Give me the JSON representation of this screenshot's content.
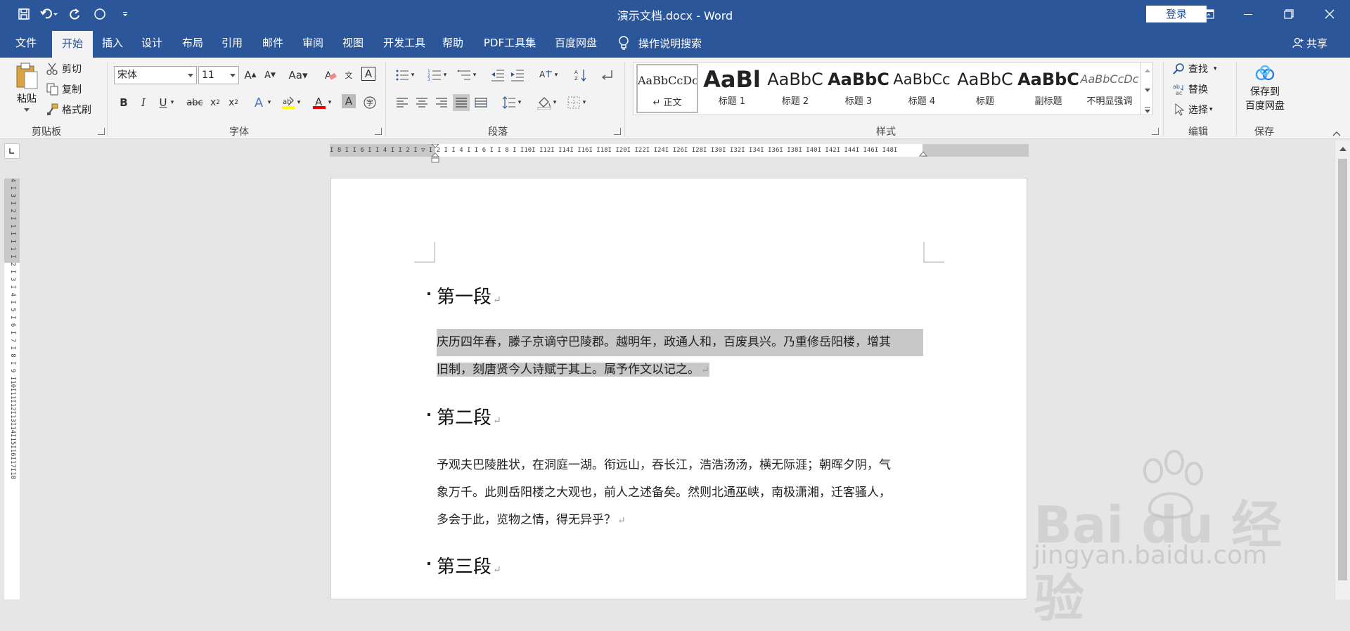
{
  "titlebar": {
    "doc_title": "演示文档.docx  -  Word",
    "login_label": "登录"
  },
  "tabs": [
    "文件",
    "开始",
    "插入",
    "设计",
    "布局",
    "引用",
    "邮件",
    "审阅",
    "视图",
    "开发工具",
    "帮助",
    "PDF工具集",
    "百度网盘"
  ],
  "active_tab": "开始",
  "tell_me": "操作说明搜索",
  "share": "共享",
  "ribbon": {
    "clipboard": {
      "label": "剪贴板",
      "paste": "粘贴",
      "cut": "剪切",
      "copy": "复制",
      "format_painter": "格式刷"
    },
    "font": {
      "label": "字体",
      "font_name": "宋体",
      "font_size": "11"
    },
    "paragraph": {
      "label": "段落"
    },
    "styles": {
      "label": "样式",
      "items": [
        {
          "sample": "AaBbCcDc",
          "name": "正文"
        },
        {
          "sample": "AaBl",
          "name": "标题 1"
        },
        {
          "sample": "AaBbC",
          "name": "标题 2"
        },
        {
          "sample": "AaBbC",
          "name": "标题 3"
        },
        {
          "sample": "AaBbCc",
          "name": "标题 4"
        },
        {
          "sample": "AaBbC",
          "name": "标题"
        },
        {
          "sample": "AaBbC",
          "name": "副标题"
        },
        {
          "sample": "AaBbCcDc",
          "name": "不明显强调"
        }
      ]
    },
    "editing": {
      "label": "编辑",
      "find": "查找",
      "replace": "替换",
      "select": "选择"
    },
    "save": {
      "label": "保存",
      "save_to_line1": "保存到",
      "save_to_line2": "百度网盘"
    }
  },
  "ruler": {
    "horizontal": "I 8 I  I 6 I  I 4 I  I 2 I   ▽  I 2 I  I 4 I  I 6 I  I 8 I  I10I  I12I  I14I  I16I  I18I  I20I  I22I  I24I  I26I  I28I  I30I  I32I  I34I  I36I  I38I  I40I  I42I  I44I  I46I  I48I",
    "vertical": "4 I 3 I 2 I 1 I  I 1 I 2 I 3 I 4 I 5 I 6 I 7 I 8 I 9 I10I11I12I13I14I15I16I17I18"
  },
  "document": {
    "heading1": "第一段",
    "para1_line1": "庆历四年春，滕子京谪守巴陵郡。越明年，政通人和，百废具兴。乃重修岳阳楼，增其",
    "para1_line2": "旧制，刻唐贤今人诗赋于其上。属予作文以记之。",
    "heading2": "第二段",
    "para2_line1": "予观夫巴陵胜状，在洞庭一湖。衔远山，吞长江，浩浩汤汤，横无际涯；朝晖夕阴，气",
    "para2_line2": "象万千。此则岳阳楼之大观也，前人之述备矣。然则北通巫峡，南极潇湘，迁客骚人，",
    "para2_line3": "多会于此，览物之情，得无异乎？",
    "heading3": "第三段",
    "return_mark": "↵"
  },
  "watermark": {
    "brand": "Bai du 经验",
    "url": "jingyan.baidu.com"
  },
  "colors": {
    "accent": "#2b579a",
    "ribbon_bg": "#f3f3f3",
    "selection": "#c8c8c8"
  }
}
